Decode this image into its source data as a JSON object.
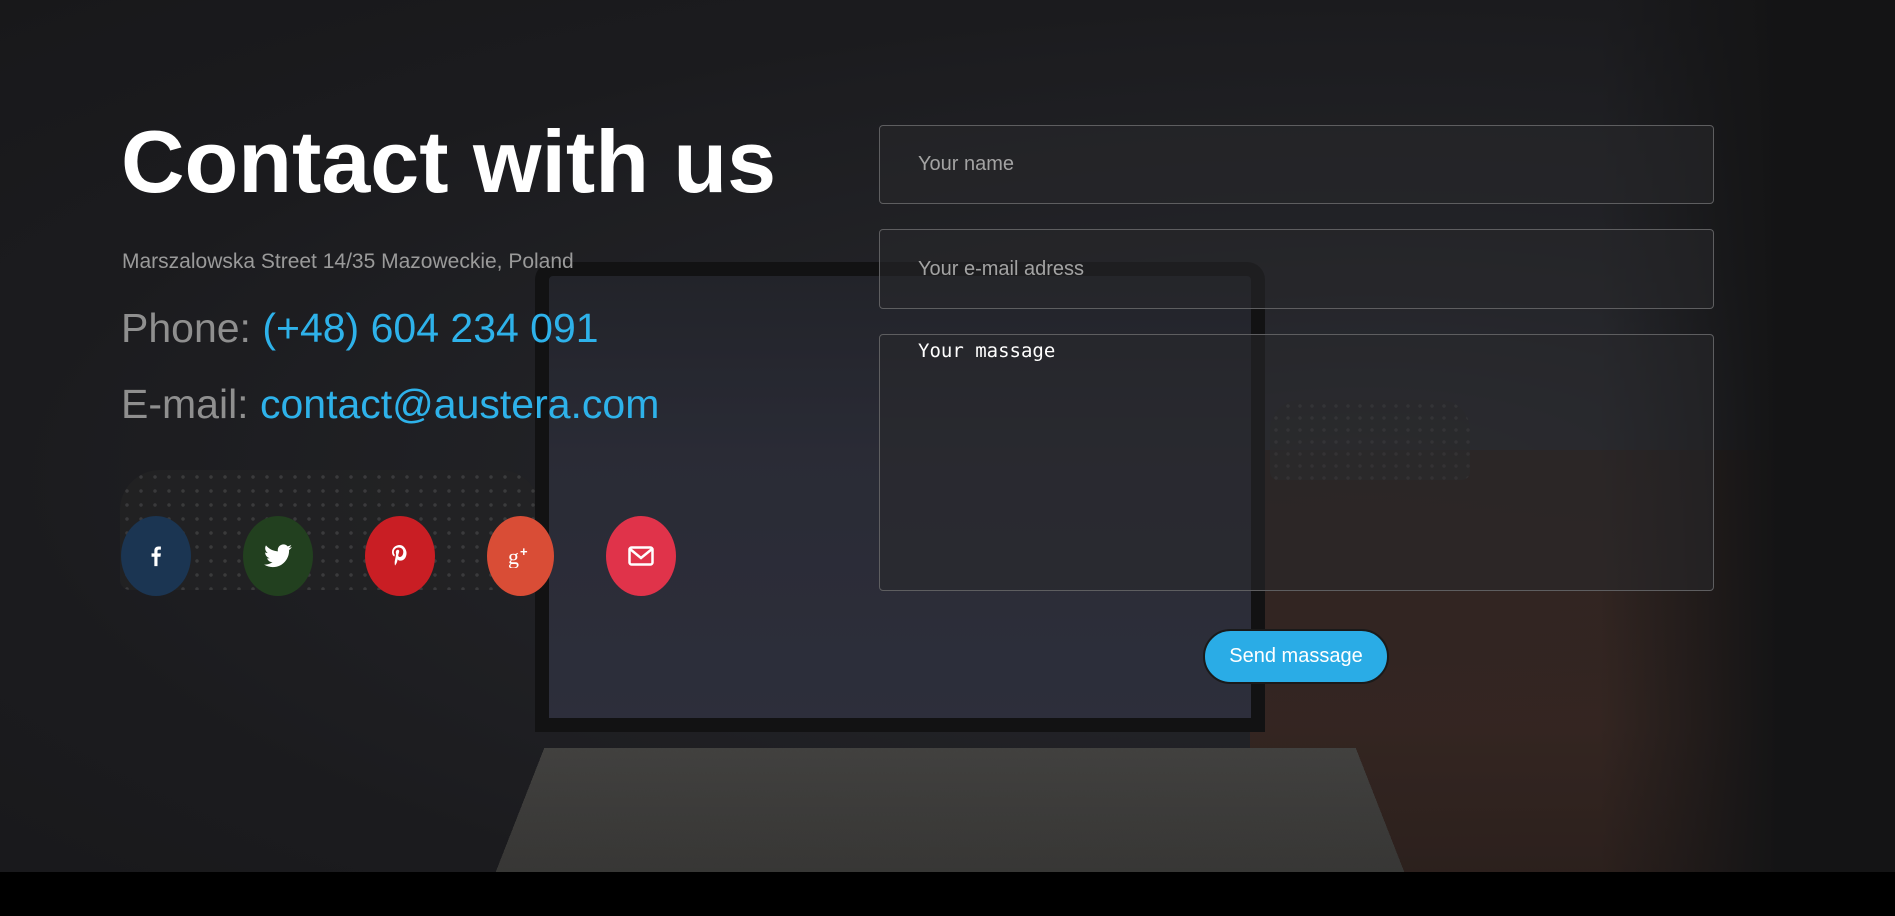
{
  "contact": {
    "title": "Contact with us",
    "address": "Marszalowska Street 14/35 Mazoweckie, Poland",
    "phone_label": "Phone: ",
    "phone_value": "(+48) 604 234 091",
    "email_label": "E-mail: ",
    "email_value": "contact@austera.com"
  },
  "social": [
    {
      "name": "facebook",
      "icon": "facebook-icon",
      "color": "#1b3552"
    },
    {
      "name": "twitter",
      "icon": "twitter-icon",
      "color": "#22401f"
    },
    {
      "name": "pinterest",
      "icon": "pinterest-icon",
      "color": "#c91e24"
    },
    {
      "name": "google-plus",
      "icon": "google-plus-icon",
      "color": "#d94d36"
    },
    {
      "name": "email",
      "icon": "mail-icon",
      "color": "#e0334a"
    }
  ],
  "form": {
    "name_placeholder": "Your name",
    "email_placeholder": "Your e-mail adress",
    "message_placeholder": "Your massage",
    "submit_label": "Send massage"
  },
  "colors": {
    "accent": "#2eb2ea",
    "button": "#2aace6"
  }
}
